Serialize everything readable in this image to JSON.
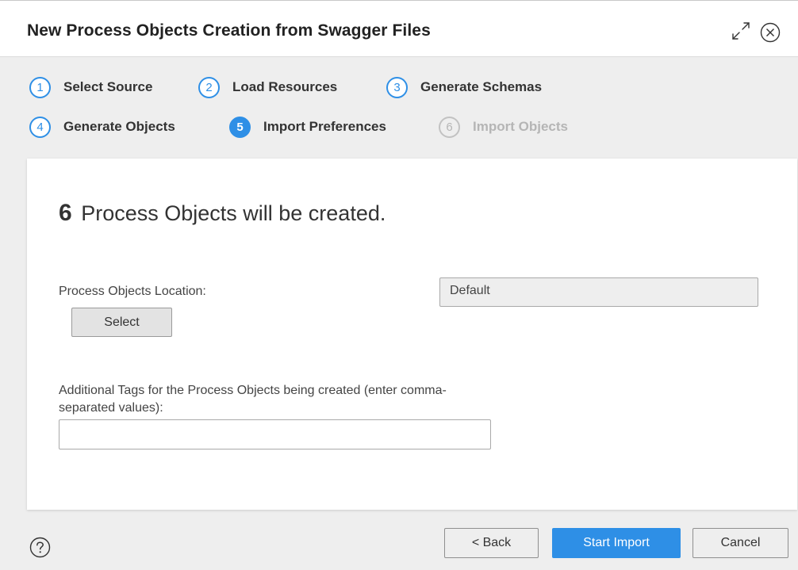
{
  "dialog": {
    "title": "New Process Objects Creation from Swagger Files"
  },
  "icons": {
    "expand": "expand-arrows-icon",
    "close": "close-circle-icon",
    "help": "help-circle-icon"
  },
  "steps": [
    {
      "number": "1",
      "label": "Select Source",
      "state": "complete"
    },
    {
      "number": "2",
      "label": "Load Resources",
      "state": "complete"
    },
    {
      "number": "3",
      "label": "Generate Schemas",
      "state": "complete"
    },
    {
      "number": "4",
      "label": "Generate Objects",
      "state": "complete"
    },
    {
      "number": "5",
      "label": "Import Preferences",
      "state": "active"
    },
    {
      "number": "6",
      "label": "Import Objects",
      "state": "disabled"
    }
  ],
  "main": {
    "object_count": "6",
    "headline_text": "Process Objects will be created.",
    "location_label": "Process Objects Location:",
    "select_button_label": "Select",
    "location_value": "Default",
    "tags_label": "Additional Tags for the Process Objects being created (enter comma-separated values):",
    "tags_value": ""
  },
  "footer": {
    "back_label": "< Back",
    "start_import_label": "Start Import",
    "cancel_label": "Cancel"
  },
  "colors": {
    "accent": "#2e8fe6",
    "panel_bg": "#eeeeee",
    "disabled_text": "#b5b5b5"
  }
}
